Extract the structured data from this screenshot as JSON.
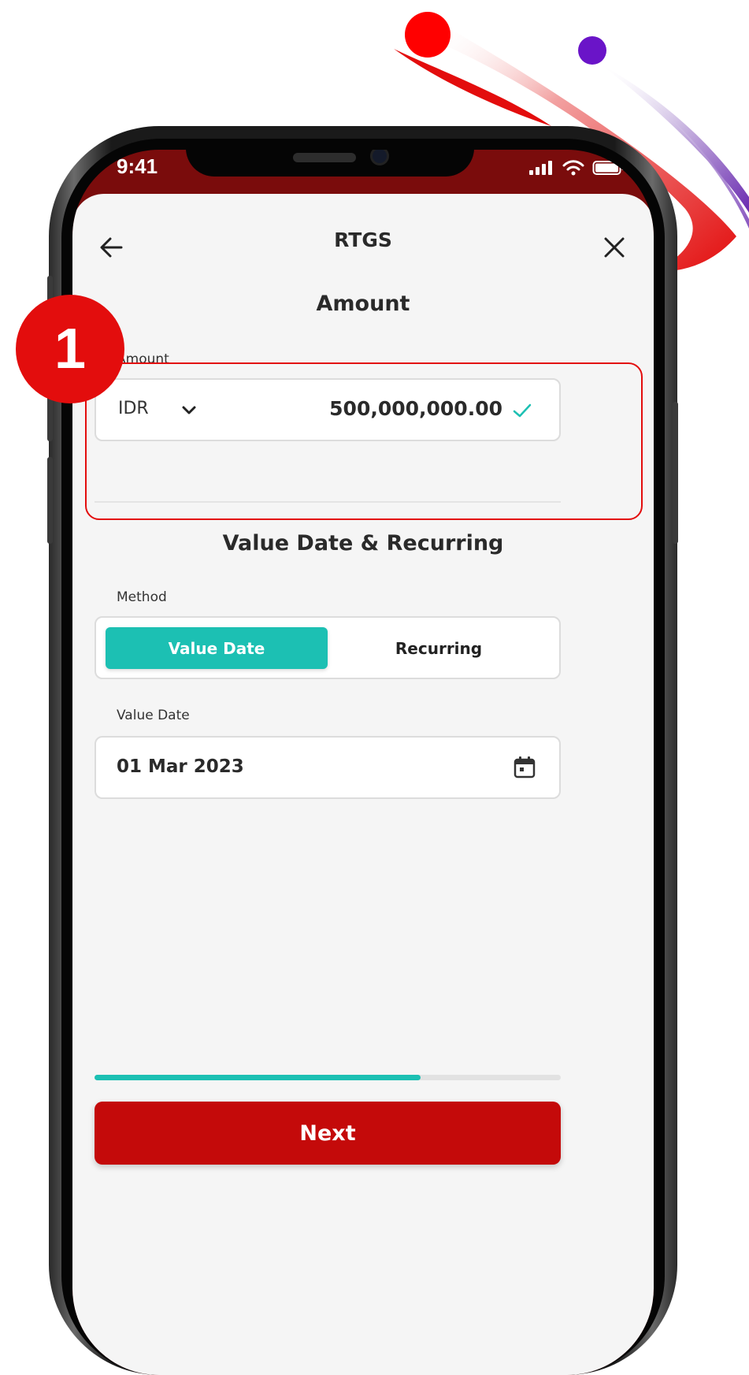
{
  "status_bar": {
    "time": "9:41"
  },
  "header": {
    "title": "RTGS"
  },
  "amount_section": {
    "title": "Amount",
    "label": "Amount",
    "currency": "IDR",
    "value": "500,000,000.00"
  },
  "value_date_section": {
    "title": "Value Date & Recurring",
    "method_label": "Method",
    "methods": [
      {
        "label": "Value Date",
        "selected": true
      },
      {
        "label": "Recurring",
        "selected": false
      }
    ],
    "date_label": "Value Date",
    "date_value": "01 Mar 2023"
  },
  "progress": {
    "fraction": 0.7
  },
  "footer": {
    "next_label": "Next"
  },
  "annotation": {
    "step_number": "1"
  },
  "colors": {
    "brand_red": "#c40a0a",
    "accent_teal": "#1cc0b3",
    "annotation_red": "#e30d0d"
  },
  "icons": [
    "back-arrow-icon",
    "close-icon",
    "chevron-down-icon",
    "check-icon",
    "calendar-icon",
    "signal-icon",
    "wifi-icon",
    "battery-icon"
  ]
}
